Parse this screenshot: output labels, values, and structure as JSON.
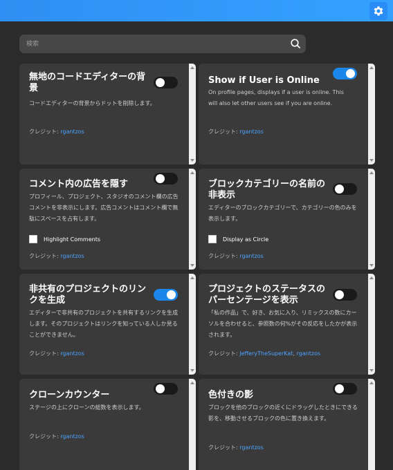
{
  "header": {
    "settings_icon": "gear-icon",
    "accent_color": "#2f8ff2"
  },
  "search": {
    "placeholder": "検索",
    "icon": "search-icon"
  },
  "cards": [
    {
      "title": "無地のコードエディターの背景",
      "description": "コードエディターの背景からドットを削除します。",
      "credit_label": "クレジット: ",
      "credits": [
        "rgantzos"
      ],
      "enabled": false
    },
    {
      "title": "Show if User is Online",
      "description": "On profile pages, displays if a user is online. This will also let other users see if you are online.",
      "credit_label": "クレジット: ",
      "credits": [
        "rgantzos"
      ],
      "enabled": true
    },
    {
      "title": "コメント内の広告を隠す",
      "description": "プロフィール、プロジェクト、スタジオのコメント欄の広告コメントを非表示にします。広告コメントはコメント欄で無駄にスペースを占有します。",
      "option_label": "Highlight Comments",
      "credit_label": "クレジット: ",
      "credits": [
        "rgantzos"
      ],
      "enabled": false
    },
    {
      "title": "ブロックカテゴリーの名前の非表示",
      "description": "エディターのブロックカテゴリーで、カテゴリーの色のみを表示します。",
      "option_label": "Display as Circle",
      "credit_label": "クレジット: ",
      "credits": [
        "rgantzos"
      ],
      "enabled": false
    },
    {
      "title": "非共有のプロジェクトのリンクを生成",
      "description": "エディターで非共有のプロジェクトを共有するリンクを生成します。そのプロジェクトはリンクを知っている人しか見ることができません。",
      "credit_label": "クレジット: ",
      "credits": [
        "rgantzos"
      ],
      "enabled": true
    },
    {
      "title": "プロジェクトのステータスのパーセンテージを表示",
      "description": "「私の作品」で、好き、お気に入り、リミックスの数にカーソルを合わせると、参照数の何%がその反応をしたかが表示されます。",
      "credit_label": "クレジット: ",
      "credits": [
        "JefferyTheSuperKat",
        "rgantzos"
      ],
      "enabled": false
    },
    {
      "title": "クローンカウンター",
      "description": "ステージの上にクローンの総数を表示します。",
      "credit_label": "クレジット: ",
      "credits": [
        "rgantzos"
      ],
      "enabled": false
    },
    {
      "title": "色付きの影",
      "description": "ブロックを他のブロックの近くにドラッグしたときにできる影を、移動させるブロックの色に置き換えます。",
      "credit_label": "クレジット: ",
      "credits": [
        "rgantzos"
      ],
      "enabled": false
    }
  ]
}
